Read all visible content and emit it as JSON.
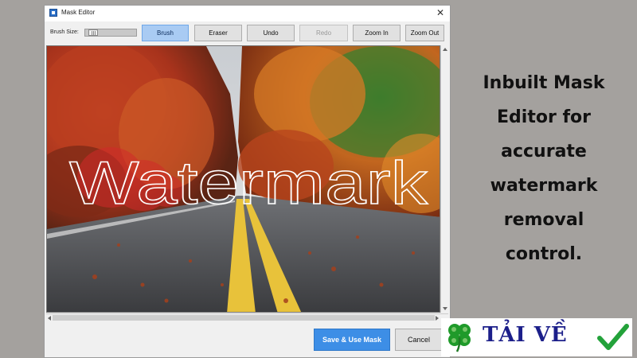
{
  "window": {
    "title": "Mask Editor",
    "close_glyph": "✕"
  },
  "toolbar": {
    "brush_size_label": "Brush Size:",
    "buttons": {
      "brush": "Brush",
      "eraser": "Eraser",
      "undo": "Undo",
      "redo": "Redo",
      "zoom_in": "Zoom In",
      "zoom_out": "Zoom Out"
    },
    "active_tool": "brush",
    "disabled": [
      "redo"
    ]
  },
  "canvas": {
    "watermark_text": "Watermark",
    "image_description_icon": "autumn-road-photo"
  },
  "footer": {
    "save_label": "Save & Use Mask",
    "cancel_label": "Cancel"
  },
  "caption": {
    "lines": [
      "Inbuilt Mask",
      "Editor for",
      "accurate",
      "watermark",
      "removal",
      "control."
    ]
  },
  "badge": {
    "text": "TẢI VỀ",
    "clover_icon": "four-leaf-clover-icon",
    "check_icon": "check-icon"
  },
  "colors": {
    "accent": "#3d8ee6",
    "active_tool_bg": "#a9cbf3",
    "mask_red": "#d12a2a",
    "badge_text": "#1c1f8a",
    "clover_green": "#1f9a2a"
  }
}
